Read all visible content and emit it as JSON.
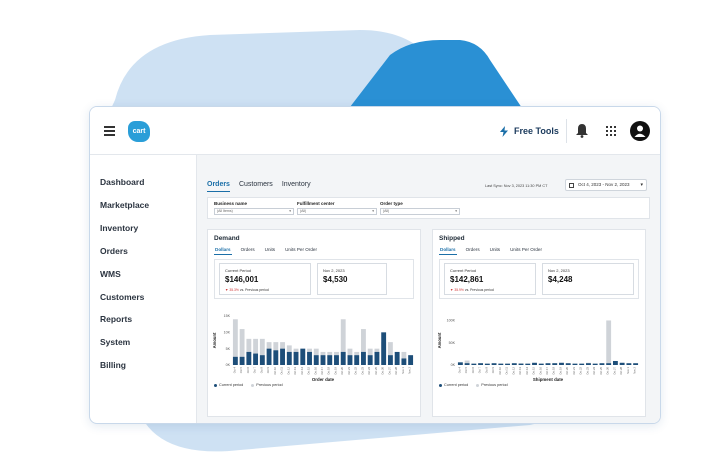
{
  "topbar": {
    "logo_text": "cart",
    "free_tools_label": "Free Tools",
    "icons": [
      "hamburger-icon",
      "lightning-icon",
      "bell-icon",
      "apps-grid-icon",
      "user-avatar-icon"
    ]
  },
  "sidebar": {
    "items": [
      {
        "label": "Dashboard"
      },
      {
        "label": "Marketplace"
      },
      {
        "label": "Inventory"
      },
      {
        "label": "Orders"
      },
      {
        "label": "WMS"
      },
      {
        "label": "Customers"
      },
      {
        "label": "Reports"
      },
      {
        "label": "System"
      },
      {
        "label": "Billing"
      }
    ]
  },
  "main": {
    "tabs": [
      {
        "label": "Orders",
        "active": true
      },
      {
        "label": "Customers",
        "active": false
      },
      {
        "label": "Inventory",
        "active": false
      }
    ],
    "last_sync": "Last Sync: Nov 3, 2023 11:30 PM CT",
    "date_range": "Oct 4, 2023 - Nov 2, 2023",
    "filters": [
      {
        "label": "Business name",
        "value": "(All Items)"
      },
      {
        "label": "Fulfillment center",
        "value": "(All)"
      },
      {
        "label": "Order type",
        "value": "(All)"
      }
    ]
  },
  "panels": {
    "demand": {
      "title": "Demand",
      "subtabs": [
        "Dollars",
        "Orders",
        "Units",
        "Units Per Order"
      ],
      "current_label": "Current Period",
      "current_value": "$146,001",
      "delta_value": "35.3%",
      "delta_suffix": "vs. Previous period",
      "compare_label": "Nov 2, 2023",
      "compare_value": "$4,530",
      "legend_current": "Current period",
      "legend_previous": "Previous period"
    },
    "shipped": {
      "title": "Shipped",
      "subtabs": [
        "Dollars",
        "Orders",
        "Units",
        "Units Per Order"
      ],
      "current_label": "Current Period",
      "current_value": "$142,861",
      "delta_value": "35.9%",
      "delta_suffix": "vs. Previous period",
      "compare_label": "Nov 2, 2023",
      "compare_value": "$4,248",
      "legend_current": "Current period",
      "legend_previous": "Previous period"
    }
  },
  "colors": {
    "accent": "#1b6fa8",
    "current_bar": "#1d4e79",
    "previous_bar": "#cfd3d8",
    "negative": "#d23b3b",
    "bg_light_shape": "#c6dcf1",
    "bg_dark_shape": "#2a90d4"
  },
  "chart_data": [
    {
      "type": "bar",
      "title": "",
      "xlabel": "Order date",
      "ylabel": "Amount",
      "yticks": [
        "0K",
        "5K",
        "10K",
        "15K"
      ],
      "ylim": [
        0,
        15
      ],
      "series": [
        {
          "name": "Previous period",
          "values": [
            14,
            11,
            8,
            8,
            8,
            7,
            7,
            7,
            6,
            5,
            5,
            5,
            5,
            4,
            4,
            4,
            14,
            5,
            4,
            11,
            5,
            5,
            7,
            7,
            3,
            4,
            3
          ]
        },
        {
          "name": "Current period",
          "values": [
            2.5,
            2.5,
            4,
            3.5,
            3,
            5,
            4.5,
            5,
            4,
            4,
            5,
            4,
            3,
            3,
            3,
            3,
            4,
            3,
            3,
            4,
            3,
            4,
            10,
            3,
            4,
            2,
            3
          ]
        }
      ],
      "categories": [
        "Oct 4",
        "Oct 5",
        "Oct 6",
        "Oct 7",
        "Oct 8",
        "Oct 9",
        "Oct 10",
        "Oct 11",
        "Oct 12",
        "Oct 13",
        "Oct 14",
        "Oct 15",
        "Oct 16",
        "Oct 17",
        "Oct 18",
        "Oct 19",
        "Oct 20",
        "Oct 21",
        "Oct 22",
        "Oct 23",
        "Oct 24",
        "Oct 25",
        "Oct 26",
        "Oct 27",
        "Oct 28",
        "Nov 1",
        "Nov 2"
      ]
    },
    {
      "type": "bar",
      "title": "",
      "xlabel": "Shipment date",
      "ylabel": "Amount",
      "yticks": [
        "0K",
        "50K",
        "100K"
      ],
      "ylim": [
        0,
        110
      ],
      "series": [
        {
          "name": "Previous period",
          "values": [
            5,
            10,
            3,
            4,
            3,
            3,
            3,
            3,
            3,
            4,
            3,
            3,
            3,
            3,
            4,
            3,
            3,
            3,
            3,
            5,
            3,
            3,
            100,
            5,
            4,
            3,
            3
          ]
        },
        {
          "name": "Current period",
          "values": [
            6,
            4,
            3,
            4,
            3,
            4,
            3,
            3,
            4,
            3,
            3,
            5,
            3,
            4,
            4,
            5,
            4,
            3,
            3,
            4,
            3,
            4,
            4,
            9,
            5,
            4,
            4
          ]
        }
      ],
      "categories": [
        "Oct 4",
        "Oct 5",
        "Oct 6",
        "Oct 7",
        "Oct 8",
        "Oct 9",
        "Oct 10",
        "Oct 11",
        "Oct 12",
        "Oct 13",
        "Oct 14",
        "Oct 15",
        "Oct 16",
        "Oct 17",
        "Oct 18",
        "Oct 19",
        "Oct 20",
        "Oct 21",
        "Oct 22",
        "Oct 23",
        "Oct 24",
        "Oct 25",
        "Oct 26",
        "Oct 27",
        "Oct 28",
        "Nov 1",
        "Nov 2"
      ]
    }
  ]
}
